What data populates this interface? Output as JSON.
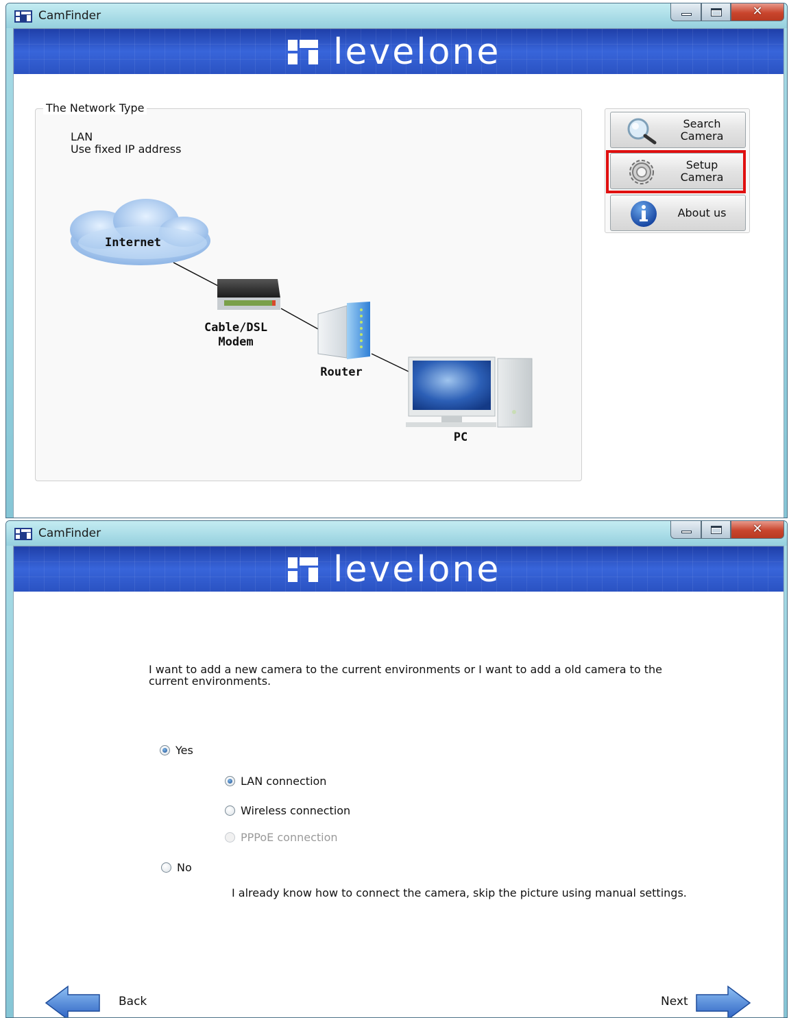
{
  "window_top": {
    "title": "CamFinder",
    "banner_text": "levelone",
    "group_legend": "The Network Type",
    "network_type_lines": [
      "LAN",
      "Use fixed IP address"
    ],
    "diagram_labels": {
      "internet": "Internet",
      "modem": "Cable/DSL\nModem",
      "router": "Router",
      "pc": "PC"
    },
    "side_buttons": {
      "search": "Search\nCamera",
      "setup": "Setup\nCamera",
      "about": "About us"
    }
  },
  "window_bottom": {
    "title": "CamFinder",
    "banner_text": "levelone",
    "question": "I want to add a new camera to the current environments or  I want to add a old camera to the current environments.",
    "options": {
      "yes": "Yes",
      "lan": "LAN connection",
      "wireless": "Wireless connection",
      "pppoe": "PPPoE connection",
      "no": "No"
    },
    "selected": {
      "yes_no": "Yes",
      "connection": "LAN connection"
    },
    "skip_note": "I already know how to connect the camera, skip the picture using manual settings.",
    "back_label": "Back",
    "next_label": "Next"
  },
  "colors": {
    "banner": "#2d55c7",
    "highlight": "#e01010",
    "arrow": "#3a78d8"
  }
}
